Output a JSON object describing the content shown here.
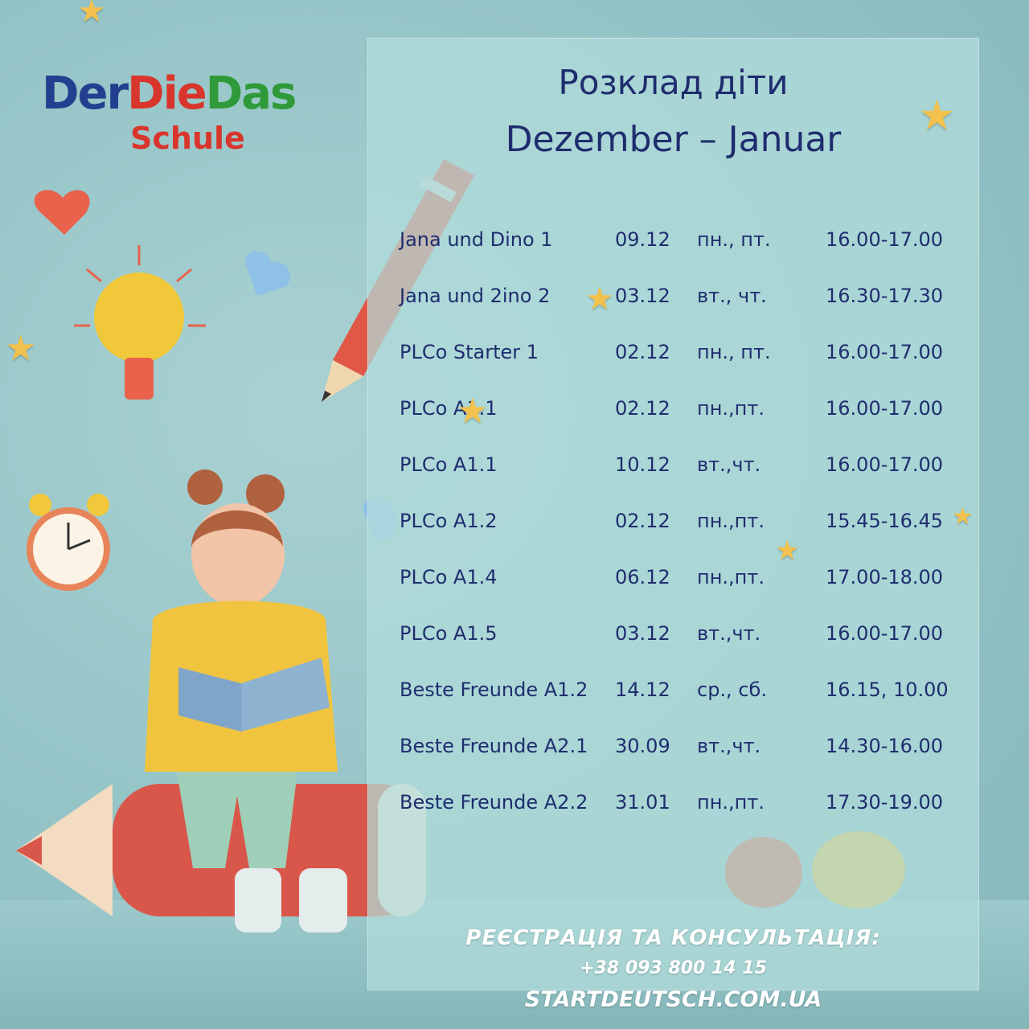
{
  "logo": {
    "der": "Der",
    "die": "Die",
    "das": "Das",
    "schule": "Schule"
  },
  "title": {
    "line1": "Розклад діти",
    "line2": "Dezember – Januar"
  },
  "schedule": [
    {
      "course": "Jana und Dino 1",
      "date": "09.12",
      "days": "пн., пт.",
      "time": "16.00-17.00"
    },
    {
      "course": "Jana und 2ino  2",
      "date": "03.12",
      "days": "вт., чт.",
      "time": "16.30-17.30"
    },
    {
      "course": "PLCo Starter  1",
      "date": "02.12",
      "days": "пн., пт.",
      "time": "16.00-17.00"
    },
    {
      "course": "PLCo    A1.1",
      "date": "02.12",
      "days": "пн.,пт.",
      "time": "16.00-17.00"
    },
    {
      "course": "PLCo    A1.1",
      "date": "10.12",
      "days": "вт.,чт.",
      "time": "16.00-17.00"
    },
    {
      "course": "PLCo    A1.2",
      "date": "02.12",
      "days": "пн.,пт.",
      "time": "15.45-16.45"
    },
    {
      "course": "PLCo    A1.4",
      "date": "06.12",
      "days": "пн.,пт.",
      "time": "17.00-18.00"
    },
    {
      "course": "PLCo    A1.5",
      "date": "03.12",
      "days": "вт.,чт.",
      "time": "16.00-17.00"
    },
    {
      "course": "Beste Freunde A1.2",
      "date": "14.12",
      "days": "ср., сб.",
      "time": "16.15,  10.00"
    },
    {
      "course": "Beste Freunde A2.1",
      "date": "30.09",
      "days": "вт.,чт.",
      "time": "14.30-16.00"
    },
    {
      "course": "Beste Freunde A2.2",
      "date": "31.01",
      "days": "пн.,пт.",
      "time": "17.30-19.00"
    }
  ],
  "footer": {
    "registration": "РЕЄСТРАЦІЯ ТА КОНСУЛЬТАЦІЯ:",
    "phone": "+38 093 800 14 15",
    "website": "STARTDEUTSCH.COM.UA"
  },
  "colors": {
    "text": "#1f2d6e",
    "red": "#d8362c",
    "blue": "#233f8f",
    "green": "#2f9a3a",
    "panel": "#b2dcdb"
  }
}
